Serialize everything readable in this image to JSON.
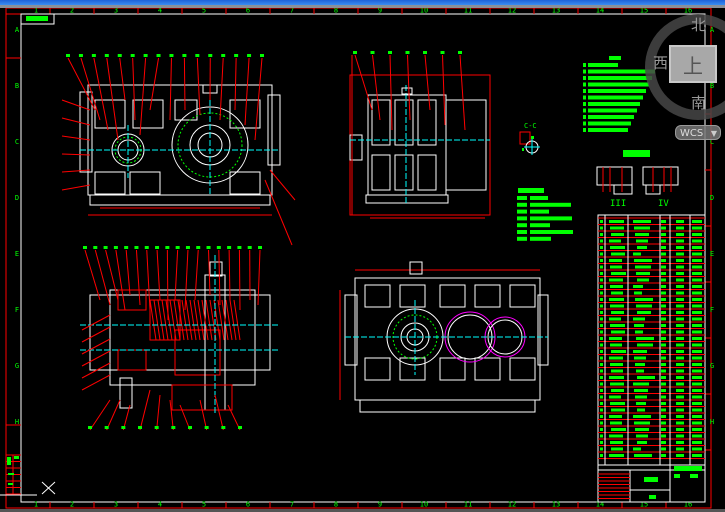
{
  "grid": {
    "columns": [
      "1",
      "2",
      "3",
      "4",
      "5",
      "6",
      "7",
      "8",
      "9",
      "10",
      "11",
      "12",
      "13",
      "14",
      "15",
      "16"
    ],
    "rows": [
      "A",
      "B",
      "C",
      "D",
      "E",
      "F",
      "G",
      "H"
    ]
  },
  "views": {
    "section_label": "C-C",
    "shaft_label_left": "III",
    "shaft_label_right": "IV"
  },
  "viewcube": {
    "north": "北",
    "west": "西",
    "south": "南",
    "top_face": "上",
    "coordinate_system": "WCS"
  },
  "colors": {
    "background": "#000000",
    "frame": "#ff0000",
    "border": "#ffffff",
    "text": "#00ff00",
    "center_lines": "#00ffff",
    "gear_circles": "#ff00ff",
    "hatching": "#ff0000"
  }
}
